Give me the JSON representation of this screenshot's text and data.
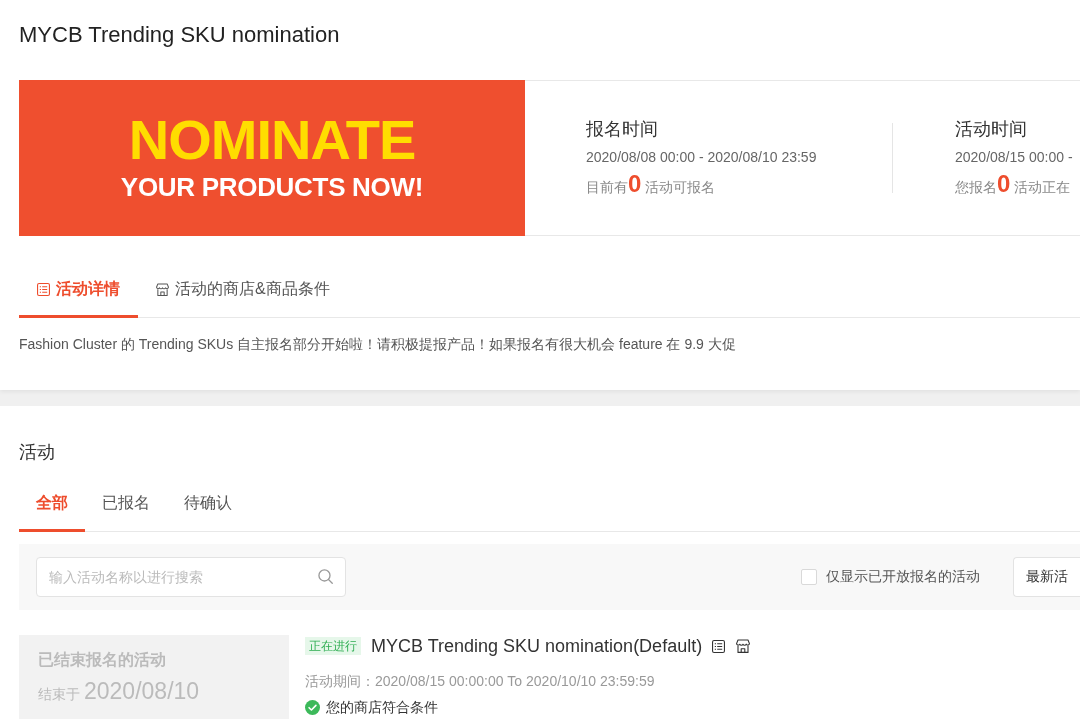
{
  "page": {
    "title": "MYCB Trending SKU nomination"
  },
  "banner": {
    "headline": "NOMINATE",
    "tagline": "YOUR PRODUCTS NOW!"
  },
  "schedule": [
    {
      "heading": "报名时间",
      "period": "2020/08/08 00:00 - 2020/08/10 23:59",
      "summary": "目前有**0** 活动可报名"
    },
    {
      "heading": "活动时间",
      "period": "2020/08/15 00:00 -",
      "summary": "您报名**0** 活动正在"
    }
  ],
  "detail_tabs": [
    {
      "label": "活动详情",
      "selected": true
    },
    {
      "label": "活动的商店&商品条件",
      "selected": false
    }
  ],
  "description": "Fashion Cluster 的 Trending SKUs 自主报名部分开始啦！请积极提报产品！如果报名有很大机会 feature 在 9.9 大促",
  "activities": {
    "heading": "活动",
    "tabs": [
      {
        "label": "全部",
        "selected": true
      },
      {
        "label": "已报名",
        "selected": false
      },
      {
        "label": "待确认",
        "selected": false
      }
    ],
    "search": {
      "placeholder": "输入活动名称以进行搜索"
    },
    "open_only_filter": {
      "label": "仅显示已开放报名的活动",
      "checked": false
    },
    "sort": {
      "value": "最新活"
    },
    "items": [
      {
        "registration": {
          "status": "已结束报名的活动",
          "ended_label": "结束于",
          "ended_date": "2020/08/10"
        },
        "status_tag": "正在进行",
        "name": "MYCB Trending SKU nomination(Default)",
        "period": "活动期间：2020/08/15 00:00:00 To 2020/10/10 23:59:59",
        "eligibility": "您的商店符合条件"
      }
    ]
  }
}
